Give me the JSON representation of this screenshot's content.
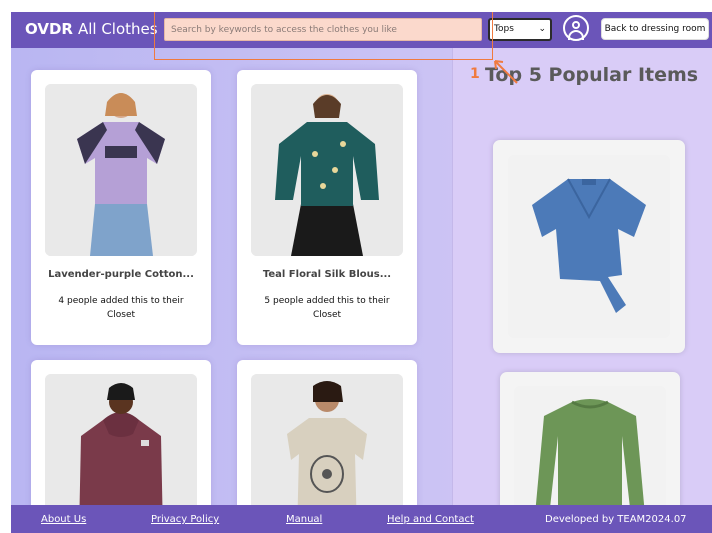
{
  "header": {
    "brand_bold": "OVDR",
    "brand_rest": "All Clothes",
    "search_placeholder": "Search by keywords to access the clothes you like",
    "category_selected": "Tops",
    "back_label": "Back to dressing room"
  },
  "annotation": {
    "number": "1"
  },
  "products": [
    {
      "title": "Lavender-purple Cotton...",
      "desc": "4 people added this to their Closet"
    },
    {
      "title": "Teal Floral Silk Blous...",
      "desc": "5 people added this to their Closet"
    },
    {
      "title": "",
      "desc": ""
    },
    {
      "title": "",
      "desc": ""
    }
  ],
  "popular": {
    "title": "Top 5 Popular Items"
  },
  "footer": {
    "about": "About Us",
    "privacy": "Privacy Policy",
    "manual": "Manual",
    "help": "Help and Contact",
    "credit": "Developed by TEAM2024.07"
  },
  "colors": {
    "brand": "#6b55b9",
    "search_bg": "#fbd9cc",
    "annotation": "#f07a3f"
  },
  "icons": [
    "user-circle-icon",
    "chevron-down-icon"
  ]
}
